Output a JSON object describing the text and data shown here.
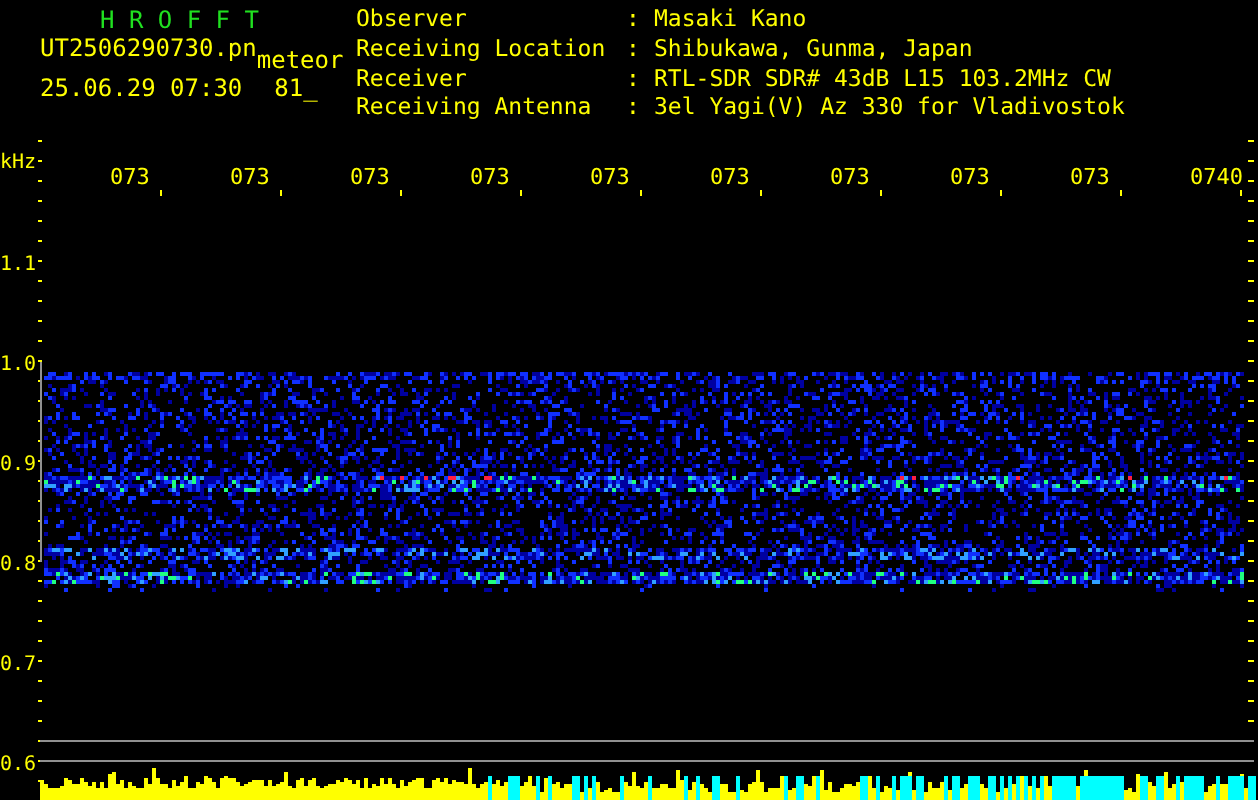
{
  "program": {
    "title": "H R O F F T",
    "file_name": "UT2506290730.pn",
    "mode": "meteor",
    "timestamp": "25.06.29 07:30",
    "count": "81_"
  },
  "station_info": [
    {
      "label": "Observer",
      "value": "Masaki Kano"
    },
    {
      "label": "Receiving Location",
      "value": "Shibukawa, Gunma, Japan"
    },
    {
      "label": "Receiver",
      "value": "RTL-SDR SDR# 43dB L15 103.2MHz CW"
    },
    {
      "label": "Receiving Antenna",
      "value": "3el Yagi(V) Az 330 for Vladivostok"
    }
  ],
  "separator": ":",
  "frequency_axis": {
    "unit": "kHz",
    "ticks": [
      "1.1",
      "1.0",
      "0.9",
      "0.8",
      "0.7",
      "0.6"
    ]
  },
  "time_axis": {
    "ticks": [
      "073",
      "073",
      "073",
      "073",
      "073",
      "073",
      "073",
      "073",
      "073",
      "0740"
    ]
  }
}
